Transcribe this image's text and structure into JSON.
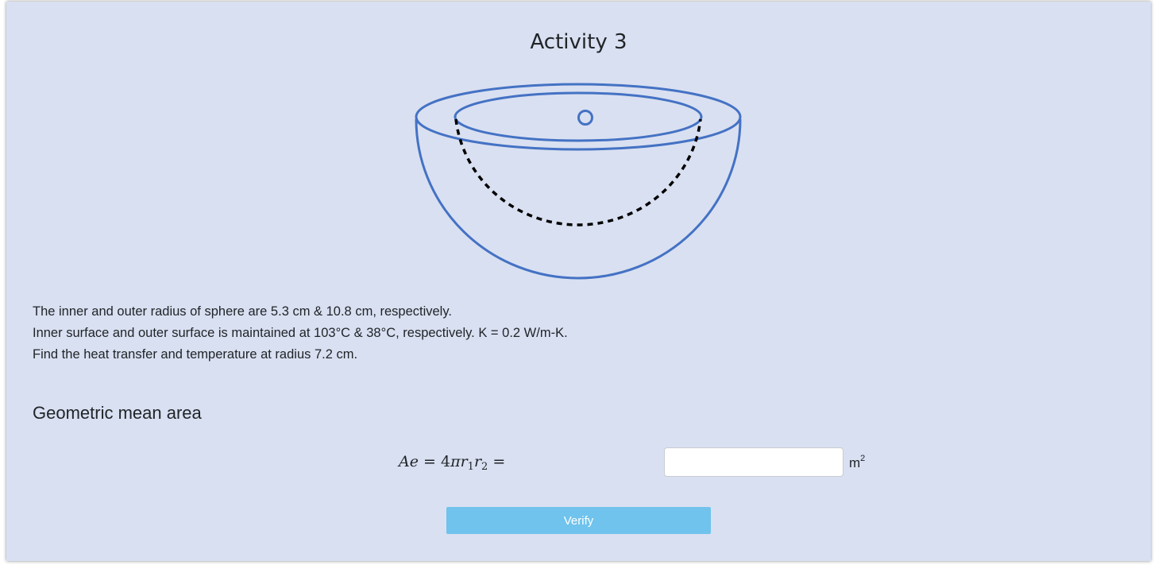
{
  "page": {
    "title": "Activity 3"
  },
  "problem": {
    "line1": "The inner and outer radius of sphere are 5.3 cm & 10.8 cm, respectively.",
    "line2": "Inner surface and outer surface is maintained at 103°C & 38°C, respectively. K = 0.2 W/m-K.",
    "line3": "Find the heat transfer and temperature at radius 7.2 cm."
  },
  "section": {
    "title": "Geometric mean area"
  },
  "formula": {
    "lhs": "Ae",
    "eq": "=",
    "coef": "4",
    "pi": "π",
    "r": "r",
    "sub1": "1",
    "sub2": "2"
  },
  "answer": {
    "value": "",
    "placeholder": ""
  },
  "unit": {
    "base": "m",
    "exponent": "2"
  },
  "buttons": {
    "verify_label": "Verify"
  },
  "colors": {
    "accent": "#6fc3ec",
    "diagram_stroke": "#4472c4",
    "background": "#d9e0f1"
  }
}
